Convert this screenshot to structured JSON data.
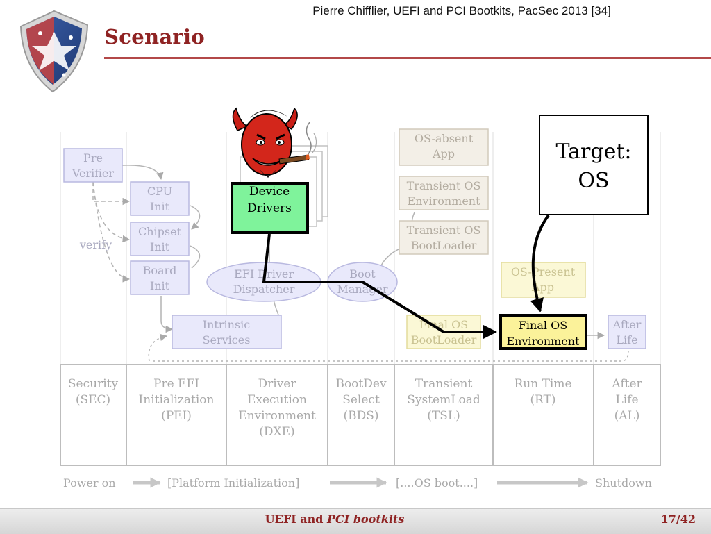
{
  "header": {
    "citation": "Pierre Chifflier, UEFI and PCI Bootkits, PacSec 2013 [34]",
    "title": "Scenario"
  },
  "diagram": {
    "nodes": {
      "pre_verifier": [
        "Pre",
        "Verifier"
      ],
      "cpu_init": [
        "CPU",
        "Init"
      ],
      "chipset_init": [
        "Chipset",
        "Init"
      ],
      "board_init": [
        "Board",
        "Init"
      ],
      "verify_label": "verify",
      "intrinsic_services": [
        "Intrinsic",
        "Services"
      ],
      "efi_driver_dispatcher": [
        "EFI Driver",
        "Dispatcher"
      ],
      "boot_manager": [
        "Boot",
        "Manager"
      ],
      "os_absent_app": [
        "OS-absent",
        "App"
      ],
      "transient_os_environment": [
        "Transient OS",
        "Environment"
      ],
      "transient_os_bootloader": [
        "Transient OS",
        "BootLoader"
      ],
      "os_present_app": [
        "OS-Present",
        "App"
      ],
      "final_os_bootloader": [
        "Final OS",
        "BootLoader"
      ],
      "final_os_environment": [
        "Final OS",
        "Environment"
      ],
      "after_life": [
        "After",
        "Life"
      ],
      "device_drivers": [
        "Device",
        "Drivers"
      ],
      "target_os": [
        "Target:",
        "OS"
      ]
    },
    "phases": [
      [
        "Security",
        "(SEC)"
      ],
      [
        "Pre EFI",
        "Initialization",
        "(PEI)"
      ],
      [
        "Driver",
        "Execution",
        "Environment",
        "(DXE)"
      ],
      [
        "BootDev",
        "Select",
        "(BDS)"
      ],
      [
        "Transient",
        "SystemLoad",
        "(TSL)"
      ],
      [
        "Run Time",
        "(RT)"
      ],
      [
        "After",
        "Life",
        "(AL)"
      ]
    ],
    "timeline": {
      "power_on": "Power on",
      "platform_init": "[Platform Initialization]",
      "os_boot": "[....OS boot....]",
      "shutdown": "Shutdown"
    },
    "colors": {
      "title_red": "#8f2323",
      "box_blue_fill": "#e9e9fb",
      "box_blue_stroke": "#b9b9e0",
      "box_beige_fill": "#f3efe7",
      "box_yellow_fill": "#fbf8d6",
      "device_drivers_fill": "#7ff39b",
      "final_os_env_fill": "#fbf29a"
    }
  },
  "footer": {
    "title_plain": "UEFI and",
    "title_italic": "PCI bootkits",
    "page": "17/42"
  }
}
